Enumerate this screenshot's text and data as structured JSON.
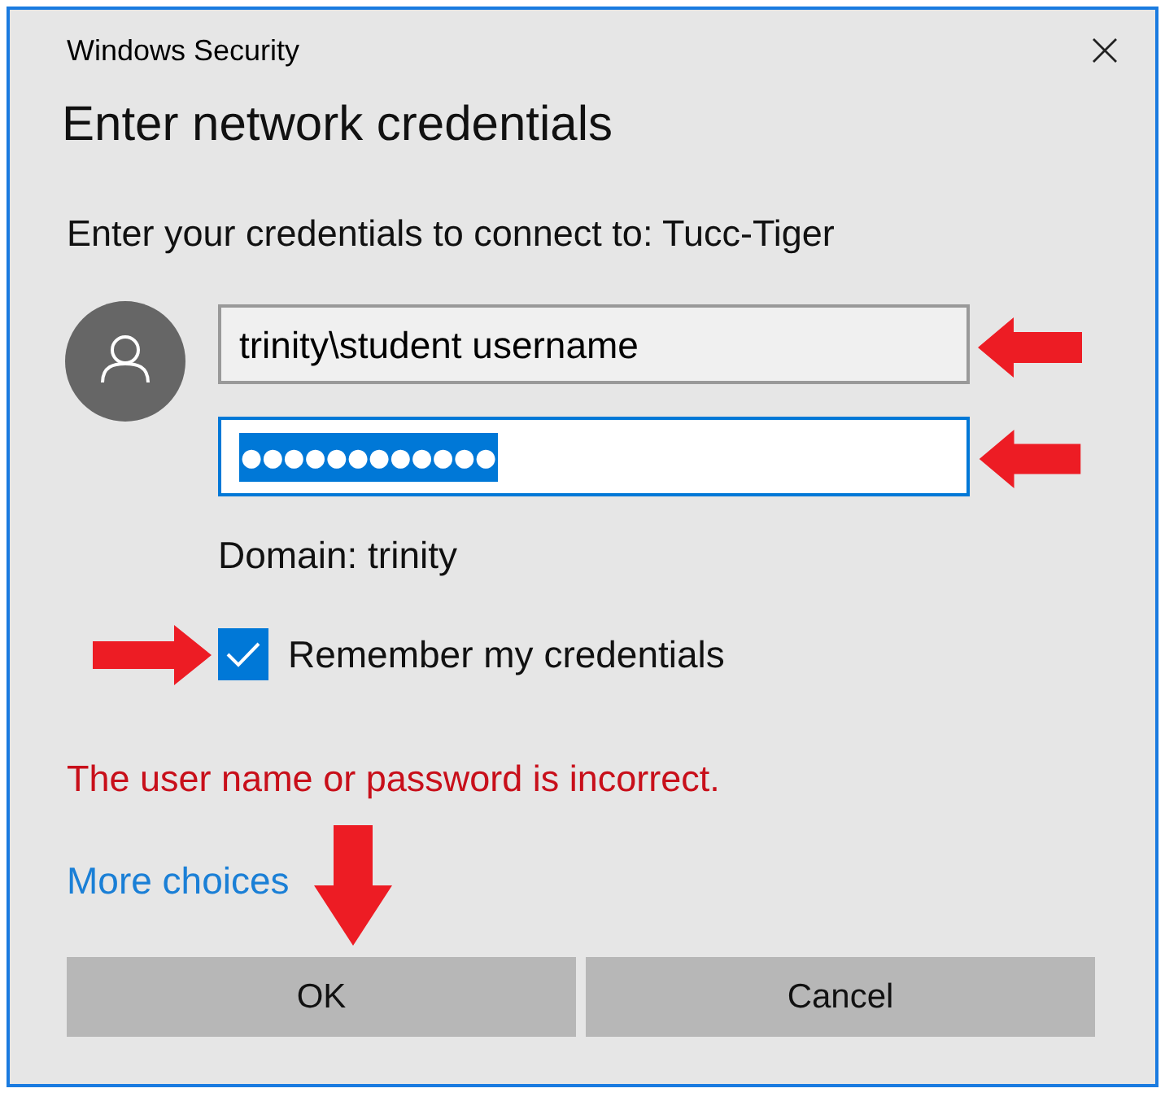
{
  "window": {
    "title": "Windows Security"
  },
  "heading": "Enter network credentials",
  "prompt": "Enter your credentials to connect to: Tucc-Tiger",
  "username_field": {
    "value": "trinity\\student username",
    "focused": false
  },
  "password_field": {
    "value": "●●●●●●●●●●●●",
    "focused": true,
    "text_selected": true
  },
  "domain": "Domain: trinity",
  "remember": {
    "label": "Remember my credentials",
    "checked": true
  },
  "error": "The user name or password is incorrect.",
  "more_choices": "More choices",
  "buttons": [
    {
      "label": "OK"
    },
    {
      "label": "Cancel"
    }
  ]
}
